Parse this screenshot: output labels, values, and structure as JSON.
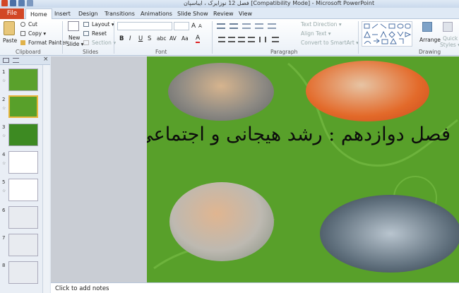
{
  "window": {
    "title": "فصل 12 نوزایرک ، ایباسپان [Compatibility Mode] - Microsoft PowerPoint"
  },
  "ribbon": {
    "tabs": [
      "File",
      "Home",
      "Insert",
      "Design",
      "Transitions",
      "Animations",
      "Slide Show",
      "Review",
      "View"
    ],
    "active_tab": "Home",
    "clipboard": {
      "paste": "Paste",
      "cut": "Cut",
      "copy": "Copy ▾",
      "format_painter": "Format Painter",
      "label": "Clipboard"
    },
    "slides": {
      "new_slide": "New",
      "new_slide_2": "Slide ▾",
      "layout": "Layout ▾",
      "reset": "Reset",
      "section": "Section ▾",
      "label": "Slides"
    },
    "font": {
      "label": "Font",
      "grow": "A",
      "shrink": "A",
      "bold": "B",
      "italic": "I",
      "underline": "U",
      "strike": "S",
      "shadow": "abc",
      "spacing": "AV",
      "case": "Aa",
      "color": "A"
    },
    "paragraph": {
      "label": "Paragraph",
      "text_direction": "Text Direction ▾",
      "align_text": "Align Text ▾",
      "convert_smartart": "Convert to SmartArt ▾"
    },
    "drawing": {
      "label": "Drawing",
      "arrange": "Arrange",
      "quick_styles": "Quick",
      "quick_styles_2": "Styles ▾"
    }
  },
  "slides_panel": {
    "thumbs": [
      "1",
      "2",
      "3",
      "4",
      "5",
      "6",
      "7",
      "8"
    ],
    "selected": "2"
  },
  "slide": {
    "title": "فصل دوازدهم : رشد هیجانی و اجتماعی در نوجوانی"
  },
  "notes": {
    "placeholder": "Click to add notes"
  },
  "colors": {
    "file_tab": "#d24726",
    "slide_bg": "#58a02a",
    "selected_thumb_border": "#e8b53c"
  }
}
